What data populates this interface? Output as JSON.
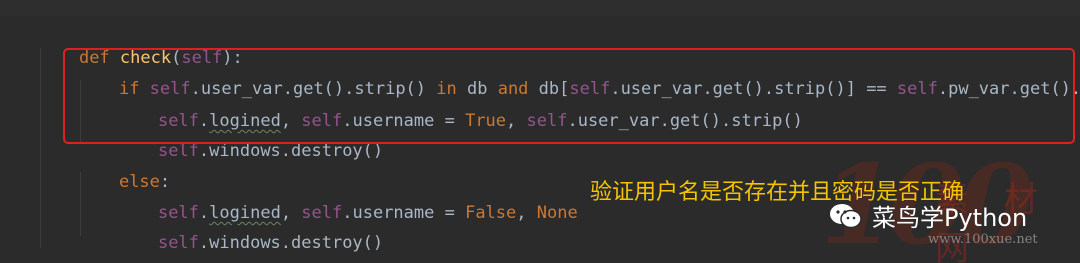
{
  "code": {
    "line1": {
      "kw_def": "def ",
      "fn_name": "check",
      "open": "(",
      "self": "self",
      "close": "):"
    },
    "line2": {
      "kw_if": "if ",
      "self1": "self",
      "t1": ".user_var.get().strip() ",
      "kw_in": "in",
      "t2": " db ",
      "kw_and": "and",
      "t3": " db[",
      "self2": "self",
      "t4": ".user_var.get().strip()] == ",
      "self3": "self",
      "t5": ".pw_var.get().strip()"
    },
    "line3": {
      "self1": "self",
      "dot1": ".",
      "logined": "logined",
      "comma": ", ",
      "self2": "self",
      "t1": ".username = ",
      "kw_true": "True",
      "comma2": ", ",
      "self3": "self",
      "t2": ".user_var.get().strip()"
    },
    "line4": {
      "self": "self",
      "t": ".windows.destroy()"
    },
    "line5": {
      "kw_else": "else",
      "colon": ":"
    },
    "line6": {
      "self1": "self",
      "dot1": ".",
      "logined": "logined",
      "comma": ", ",
      "self2": "self",
      "t1": ".username = ",
      "kw_false": "False",
      "comma2": ", ",
      "kw_none": "None"
    },
    "line7": {
      "self": "self",
      "t": ".windows.destroy()"
    }
  },
  "annotation": "验证用户名是否存在并且密码是否正确",
  "watermark": {
    "number": "100",
    "site_cn": "素 材 网",
    "url": "www.100xue.net"
  },
  "badge": {
    "icon": "wechat-icon",
    "label": "菜鸟学Python"
  },
  "colors": {
    "background": "#2b2b2b",
    "keyword": "#cc7832",
    "self": "#94558d",
    "function": "#ffc66d",
    "text": "#a9b7c6",
    "highlight_box": "#e02020",
    "annotation": "#f5c400"
  }
}
